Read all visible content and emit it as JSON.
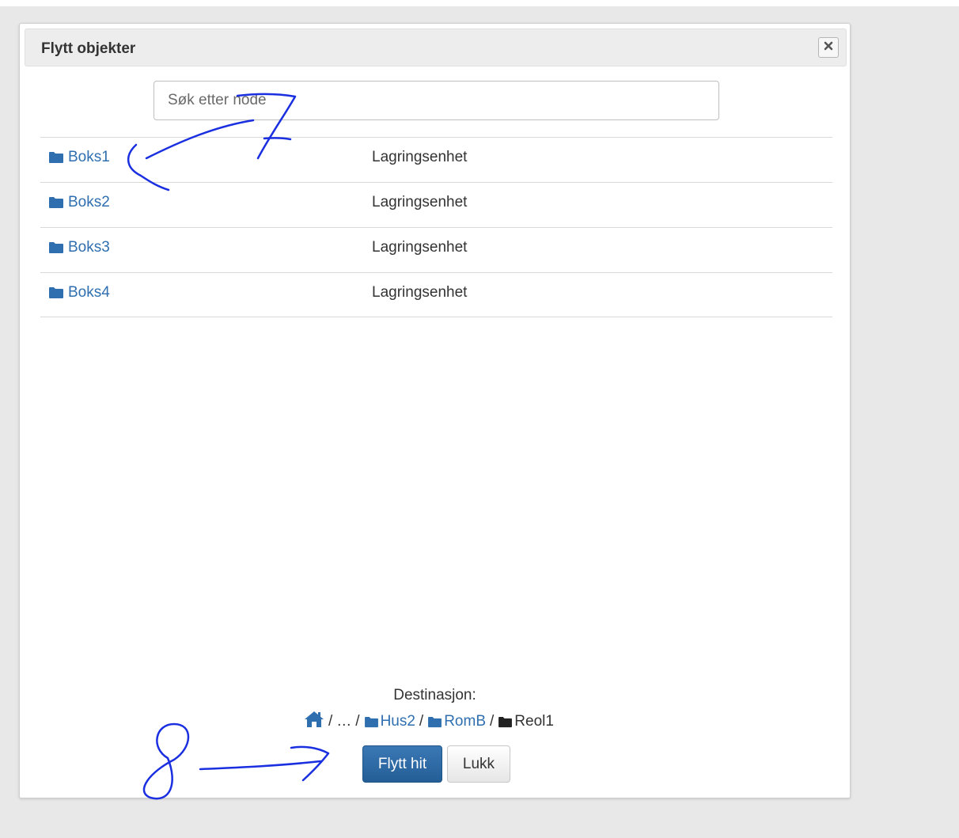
{
  "dialog": {
    "title": "Flytt objekter"
  },
  "search": {
    "placeholder": "Søk etter node"
  },
  "nodes": [
    {
      "name": "Boks1",
      "type": "Lagringsenhet"
    },
    {
      "name": "Boks2",
      "type": "Lagringsenhet"
    },
    {
      "name": "Boks3",
      "type": "Lagringsenhet"
    },
    {
      "name": "Boks4",
      "type": "Lagringsenhet"
    }
  ],
  "destination": {
    "label": "Destinasjon:",
    "ellipsis": "…",
    "crumbs": [
      "Hus2",
      "RomB"
    ],
    "current": "Reol1"
  },
  "buttons": {
    "move": "Flytt hit",
    "close": "Lukk"
  },
  "icons": {
    "close": "close-icon",
    "folder": "folder-icon",
    "home": "home-icon"
  },
  "colors": {
    "link": "#2f6fb0",
    "primary": "#2a6aa6",
    "annotation": "#1a2fe0"
  }
}
